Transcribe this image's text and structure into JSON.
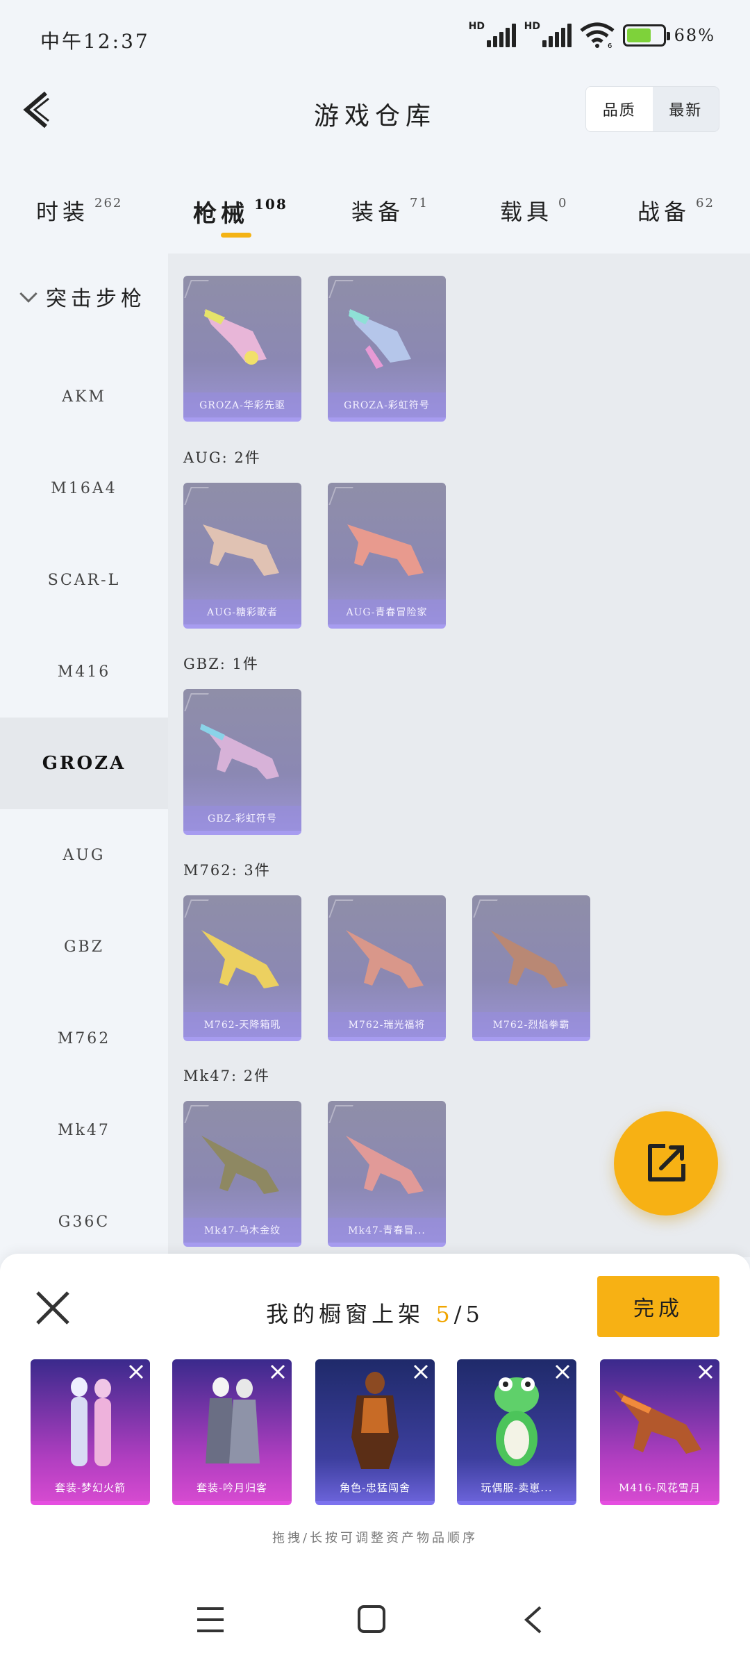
{
  "status_bar": {
    "time": "中午12:37",
    "network_1": "HD",
    "network_2": "HD",
    "wifi_badge": "6",
    "battery": "68%",
    "battery_level": 0.68
  },
  "header": {
    "title": "游戏仓库",
    "sort_quality": "品质",
    "sort_newest": "最新"
  },
  "tabs": [
    {
      "label": "时装",
      "count": "262"
    },
    {
      "label": "枪械",
      "count": "108"
    },
    {
      "label": "装备",
      "count": "71"
    },
    {
      "label": "载具",
      "count": "0"
    },
    {
      "label": "战备",
      "count": "62"
    }
  ],
  "sidebar": {
    "group": "突击步枪",
    "items": [
      "AKM",
      "M16A4",
      "SCAR-L",
      "M416",
      "GROZA",
      "AUG",
      "GBZ",
      "M762",
      "Mk47",
      "G36C"
    ],
    "active": "GROZA"
  },
  "groups": [
    {
      "header": "",
      "items": [
        "GROZA-华彩先驱",
        "GROZA-彩虹符号"
      ]
    },
    {
      "header": "AUG: 2件",
      "items": [
        "AUG-糖彩歌者",
        "AUG-青春冒险家"
      ]
    },
    {
      "header": "GBZ: 1件",
      "items": [
        "GBZ-彩虹符号"
      ]
    },
    {
      "header": "M762: 3件",
      "items": [
        "M762-天降箱吼",
        "M762-瑞光福将",
        "M762-烈焰拳霸"
      ]
    },
    {
      "header": "Mk47: 2件",
      "items": [
        "Mk47-乌木金纹",
        "Mk47-青春冒..."
      ]
    }
  ],
  "sheet": {
    "title": "我的橱窗上架",
    "current": "5",
    "total": "/5",
    "done_label": "完成",
    "items": [
      "套装-梦幻火箭",
      "套装-吟月归客",
      "角色-忠猛闯舍",
      "玩偶服-卖崽...",
      "M416-风花雪月"
    ],
    "hint": "拖拽/长按可调整资产物品顺序"
  },
  "colors": {
    "accent": "#f7b114",
    "card_purple": "#8b88b3",
    "shelf_magenta": "#c43bc4"
  }
}
